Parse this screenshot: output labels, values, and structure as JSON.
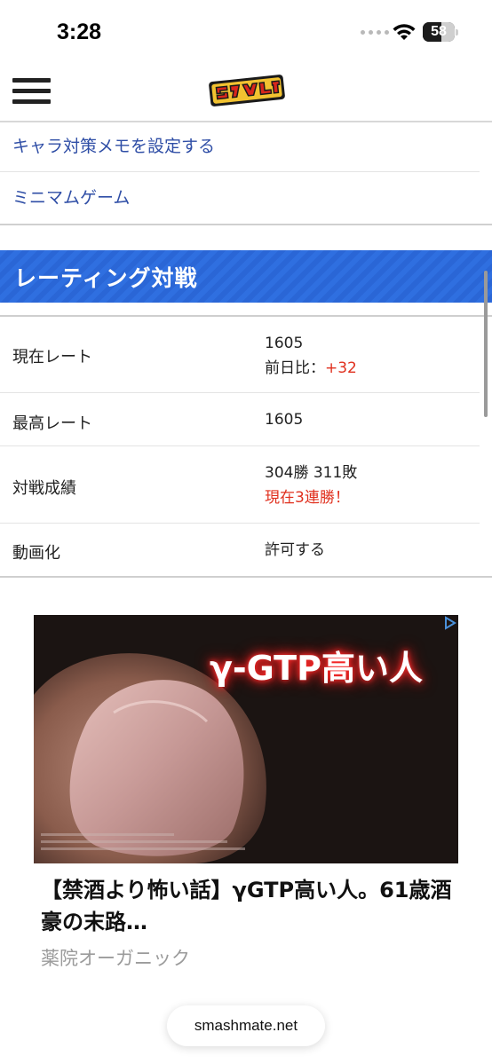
{
  "status_bar": {
    "time": "3:28",
    "battery": "58",
    "battery_level": 0.58
  },
  "header": {
    "logo_alt": "スマメイト"
  },
  "menu": {
    "items": [
      {
        "label": "キャラ対策メモを設定する"
      },
      {
        "label": "ミニマムゲーム"
      }
    ]
  },
  "rating": {
    "title": "レーティング対戦",
    "rows": [
      {
        "label": "現在レート",
        "value": "1605",
        "sub_prefix": "前日比：",
        "sub_value": "+32"
      },
      {
        "label": "最高レート",
        "value": "1605"
      },
      {
        "label": "対戦成績",
        "value": "304勝 311敗",
        "sub_value": "現在3連勝！"
      },
      {
        "label": "動画化",
        "value": "許可する"
      }
    ]
  },
  "ad": {
    "image_text": "γ-GTP高い人",
    "title": "【禁酒より怖い話】γGTP高い人。61歳酒豪の末路…",
    "sponsor": "薬院オーガニック"
  },
  "browser": {
    "url": "smashmate.net"
  },
  "colors": {
    "link": "#2f4ea6",
    "accent_blue": "#2f6fe0",
    "red": "#e0301e"
  }
}
